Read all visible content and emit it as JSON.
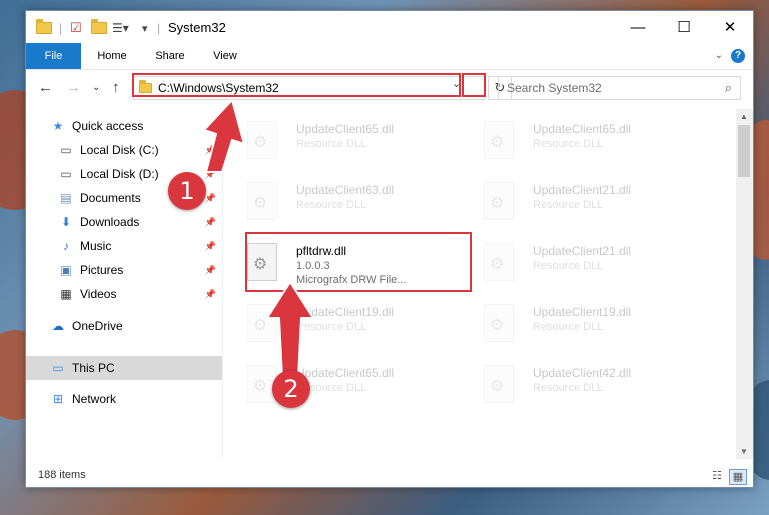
{
  "window": {
    "title": "System32",
    "controls": {
      "minimize": "—",
      "maximize": "☐",
      "close": "✕"
    }
  },
  "ribbon": {
    "tabs": [
      "File",
      "Home",
      "Share",
      "View"
    ],
    "help": "?"
  },
  "address_bar": {
    "path": "C:\\Windows\\System32",
    "search_placeholder": "Search System32"
  },
  "sidebar": {
    "items": [
      {
        "label": "Quick access",
        "icon": "star-icon"
      },
      {
        "label": "Local Disk (C:)",
        "icon": "drive-icon"
      },
      {
        "label": "Local Disk (D:)",
        "icon": "drive-icon"
      },
      {
        "label": "Documents",
        "icon": "documents-icon"
      },
      {
        "label": "Downloads",
        "icon": "download-icon"
      },
      {
        "label": "Music",
        "icon": "music-icon"
      },
      {
        "label": "Pictures",
        "icon": "pictures-icon"
      },
      {
        "label": "Videos",
        "icon": "videos-icon"
      },
      {
        "label": "OneDrive",
        "icon": "cloud-icon"
      },
      {
        "label": "This PC",
        "icon": "computer-icon"
      },
      {
        "label": "Network",
        "icon": "network-icon"
      }
    ]
  },
  "files": {
    "highlighted": {
      "name": "pfltdrw.dll",
      "version": "1.0.0.3",
      "description": "Micrografx DRW File..."
    },
    "background": [
      {
        "name": "UpdateClient65.dll",
        "type": "Resource DLL"
      },
      {
        "name": "UpdateClient65.dll",
        "type": "Resource DLL"
      },
      {
        "name": "UpdateClient63.dll",
        "type": "Resource DLL"
      },
      {
        "name": "UpdateClient21.dll",
        "type": "Resource DLL"
      },
      {
        "name": "UpdateClient21.dll",
        "type": "Resource DLL"
      },
      {
        "name": "UpdateClient19.dll",
        "type": "Resource DLL"
      },
      {
        "name": "UpdateClient19.dll",
        "type": "Resource DLL"
      },
      {
        "name": "UpdateClient65.dll",
        "type": "Resource DLL"
      },
      {
        "name": "UpdateClient42.dll",
        "type": "Resource DLL"
      }
    ]
  },
  "status": {
    "item_count": "188 items"
  },
  "annotations": {
    "step1": "1",
    "step2": "2"
  },
  "colors": {
    "accent": "#1979ca",
    "highlight_red": "#d9363e",
    "selected_bg": "#d9d9d9"
  }
}
